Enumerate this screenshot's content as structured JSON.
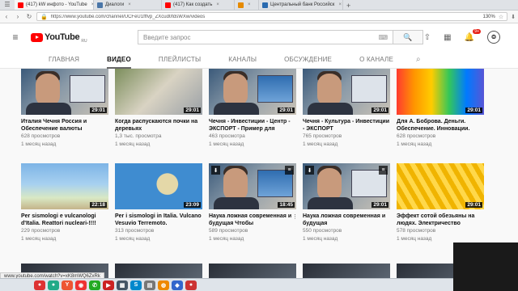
{
  "browser": {
    "tabs": [
      {
        "label": "(417) kW инфото - YouTube",
        "color": "#ff0000",
        "active": true
      },
      {
        "label": "Диалоги",
        "color": "#4a76a8",
        "active": false
      },
      {
        "label": "(417) Как создать",
        "color": "#ff0000",
        "active": false
      },
      {
        "label": "",
        "color": "#e68a00",
        "active": false
      },
      {
        "label": "Центральный банк Российск",
        "color": "#2a6bb0",
        "active": false
      }
    ],
    "new_tab": "+",
    "url": "https://www.youtube.com/channel/UCFeU1fffvp_ZXcud0fdsWXw/videos",
    "zoom": "130%"
  },
  "youtube": {
    "logo_text": "YouTube",
    "logo_region": "RU",
    "search_placeholder": "Введите запрос",
    "notifications_count": "9+"
  },
  "channel_tabs": [
    "ГЛАВНАЯ",
    "ВИДЕО",
    "ПЛЕЙЛИСТЫ",
    "КАНАЛЫ",
    "ОБСУЖДЕНИЕ",
    "О КАНАЛЕ"
  ],
  "active_tab": "ВИДЕО",
  "videos": [
    {
      "title": "Италия Чечня Россия и Обеспечение валюты",
      "views": "628 просмотров",
      "age": "1 месяц назад",
      "duration": "29:01",
      "thumb": "th-face"
    },
    {
      "title": "Когда распускаются почки на деревьях",
      "views": "1,3 тыс. просмотра",
      "age": "1 месяц назад",
      "duration": "29:01",
      "thumb": "th-tree"
    },
    {
      "title": "Чечня - Инвестиции - Центр - ЭКСПОРТ - Пример для",
      "views": "463 просмотра",
      "age": "1 месяц назад",
      "duration": "29:01",
      "thumb": "th-face th-blue"
    },
    {
      "title": "Чечня - Культура - Инвестиции - ЭКСПОРТ",
      "views": "765 просмотров",
      "age": "1 месяц назад",
      "duration": "29:01",
      "thumb": "th-face"
    },
    {
      "title": "Для А. Боброва. Деньги. Обеспечение. Инновации.",
      "views": "628 просмотров",
      "age": "1 месяц назад",
      "duration": "29:01",
      "thumb": "th-spec"
    },
    {
      "title": "Per sismologi e vulcanologi d'Italia. Reattori nucleari-!!!!",
      "views": "229 просмотров",
      "age": "1 месяц назад",
      "duration": "22:18",
      "thumb": "th-map"
    },
    {
      "title": "Per i sismologi in Italia. Vulcano Vesuvio Terremoto.",
      "views": "313 просмотров",
      "age": "1 месяц назад",
      "duration": "23:09",
      "thumb": "th-map2"
    },
    {
      "title": "Наука ложная современная и будущая Чтобы",
      "views": "589 просмотров",
      "age": "1 месяц назад",
      "duration": "18:45",
      "thumb": "th-face th-blue"
    },
    {
      "title": "Наука ложная современная и будущая",
      "views": "550 просмотров",
      "age": "1 месяц назад",
      "duration": "29:01",
      "thumb": "th-face"
    },
    {
      "title": "Эффект сотой обезьяны на людях. Электричество",
      "views": "578 просмотров",
      "age": "1 месяц назад",
      "duration": "29:01",
      "thumb": "th-hex"
    }
  ],
  "status_url": "www.youtube.com/watch?v=xK8mWQ6ZxRk"
}
